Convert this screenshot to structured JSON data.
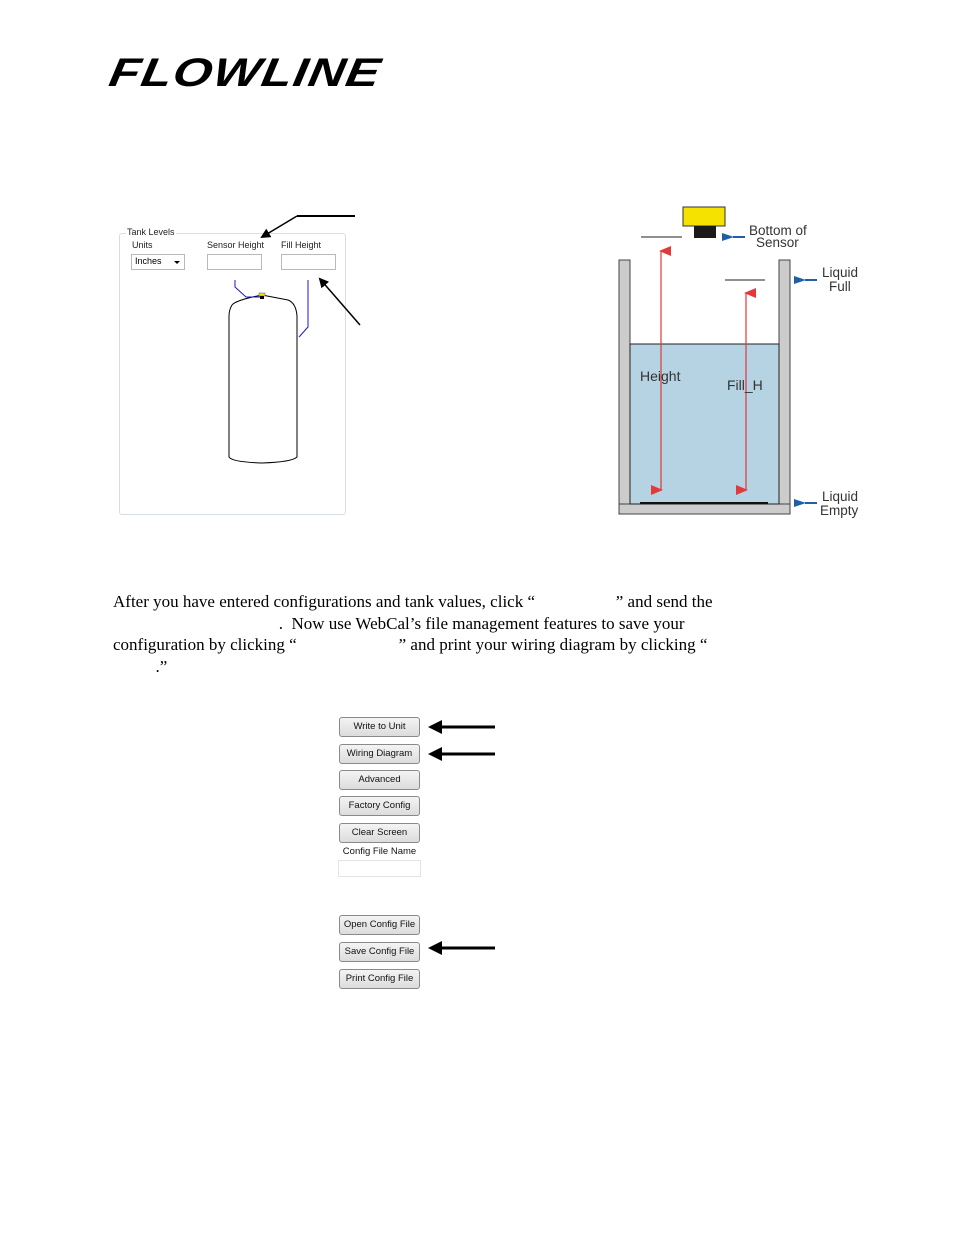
{
  "header": {
    "logo_text": "FLOWLINE"
  },
  "tank_levels_panel": {
    "legend": "Tank Levels",
    "units_label": "Units",
    "units_value": "Inches",
    "sensor_height_label": "Sensor Height",
    "sensor_height_value": "",
    "fill_height_label": "Fill Height",
    "fill_height_value": ""
  },
  "tank_diagram": {
    "bottom_of_sensor": [
      "Bottom of",
      "Sensor"
    ],
    "liquid_full": [
      "Liquid",
      "Full"
    ],
    "liquid_empty": [
      "Liquid",
      "Empty"
    ],
    "height_label": "Height",
    "fill_label": "Fill_H",
    "colors": {
      "liquid": "#b5d3e2",
      "wall": "#cccccc",
      "arrow_red": "#e03a3a",
      "arrow_blue": "#1f5fa8",
      "sensor": "#f5e200"
    }
  },
  "paragraph": {
    "lines": [
      "After you have entered configurations and tank values, click “                   ” and send the",
      "                                       .  Now use WebCal’s file management features to save your",
      "configuration by clicking “                        ” and print your wiring diagram by clicking “",
      "          .”"
    ]
  },
  "buttons": {
    "write_to_unit": "Write to Unit",
    "wiring_diagram": "Wiring Diagram",
    "advanced": "Advanced",
    "factory_config": "Factory Config",
    "clear_screen": "Clear Screen",
    "config_file_name_label": "Config File Name",
    "config_file_name_value": "",
    "open_config_file": "Open Config File",
    "save_config_file": "Save Config File",
    "print_config_file": "Print Config File"
  }
}
